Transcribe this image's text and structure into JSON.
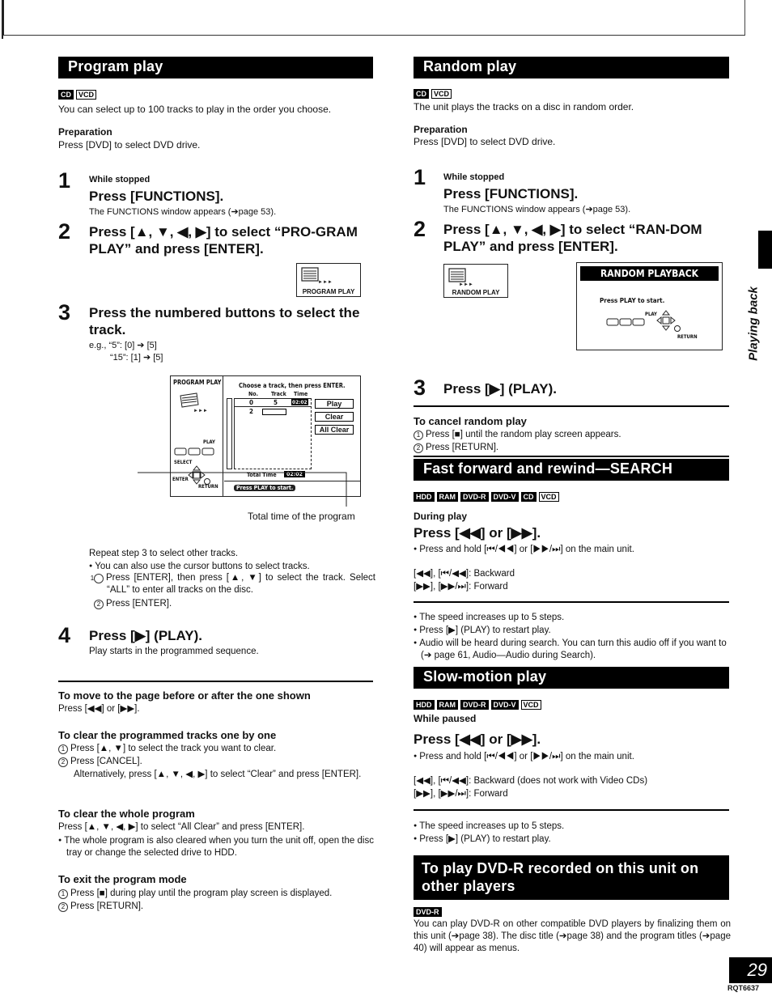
{
  "page": {
    "page_number": "29",
    "doc_id": "RQT6637",
    "side_tab_label": "Playing back"
  },
  "program_play": {
    "title": "Program play",
    "badges": [
      {
        "label": "CD",
        "style": "fill"
      },
      {
        "label": "VCD",
        "style": "outline"
      }
    ],
    "intro": "You can select up to 100 tracks to play in the order you choose.",
    "prep_label": "Preparation",
    "prep_text": "Press [DVD] to select DVD drive.",
    "steps": [
      {
        "num": "1",
        "pre": "While stopped",
        "title": "Press [FUNCTIONS].",
        "note": "The FUNCTIONS window appears (➔page 53)."
      },
      {
        "num": "2",
        "title": "Press [▲, ▼, ◀, ▶] to select “PRO-GRAM PLAY” and press [ENTER].",
        "icon_label": "PROGRAM PLAY"
      },
      {
        "num": "3",
        "title": "Press the numbered buttons to select the track.",
        "eg1": "e.g., “5”:   [0] ➔ [5]",
        "eg2": "“15”: [1] ➔ [5]"
      },
      {
        "num": "4",
        "title": "Press [▶] (PLAY).",
        "note": "Play starts in the programmed sequence."
      }
    ],
    "osd": {
      "side_title": "PROGRAM PLAY",
      "instruction": "Choose a track, then press ENTER.",
      "col_no": "No.",
      "col_track": "Track",
      "col_time": "Time",
      "rows": [
        {
          "no": "0",
          "track": "5",
          "time": "02:02"
        },
        {
          "no": "2",
          "track": "",
          "time": ""
        }
      ],
      "buttons": [
        "Play",
        "Clear",
        "All Clear"
      ],
      "total_label": "Total Time",
      "total_value": "02:02",
      "footer": "Press PLAY to start.",
      "play_label": "PLAY",
      "select_label": "SELECT",
      "enter_label": "ENTER",
      "return_label": "RETURN"
    },
    "callout": "Total time of the program",
    "repeat": "Repeat step 3 to select other tracks.",
    "cursor_bullet": "You can also use the cursor buttons to select tracks.",
    "cursor_sub1": "Press [ENTER], then press [▲, ▼] to select the track. Select “ALL” to enter all tracks on the disc.",
    "cursor_sub2": "Press [ENTER].",
    "move_head": "To move to the page before or after the one shown",
    "move_text": "Press [◀◀] or [▶▶].",
    "clear_one_head": "To clear the programmed tracks one by one",
    "clear_one_1": "Press [▲, ▼] to select the track you want to clear.",
    "clear_one_2": "Press [CANCEL].",
    "clear_one_alt": "Alternatively, press [▲, ▼, ◀, ▶] to select “Clear” and press [ENTER].",
    "clear_all_head": "To clear the whole program",
    "clear_all_text": "Press [▲, ▼, ◀, ▶] to select “All Clear” and press [ENTER].",
    "clear_all_bullet": "The whole program is also cleared when you turn the unit off, open the disc tray or change the selected drive to HDD.",
    "exit_head": "To exit the program mode",
    "exit_1": "Press [■] during play until the program play screen is displayed.",
    "exit_2": "Press [RETURN]."
  },
  "random_play": {
    "title": "Random play",
    "badges": [
      {
        "label": "CD",
        "style": "fill"
      },
      {
        "label": "VCD",
        "style": "outline"
      }
    ],
    "intro": "The unit plays the tracks on a disc in random order.",
    "prep_label": "Preparation",
    "prep_text": "Press [DVD] to select DVD drive.",
    "steps": [
      {
        "num": "1",
        "pre": "While stopped",
        "title": "Press [FUNCTIONS].",
        "note": "The FUNCTIONS window appears (➔page 53)."
      },
      {
        "num": "2",
        "title": "Press [▲, ▼, ◀, ▶] to select “RAN-DOM PLAY” and press [ENTER].",
        "icon_label": "RANDOM PLAY"
      },
      {
        "num": "3",
        "title": "Press [▶] (PLAY)."
      }
    ],
    "osd": {
      "title": "RANDOM PLAYBACK",
      "message": "Press PLAY to start.",
      "play_label": "PLAY",
      "return_label": "RETURN"
    },
    "cancel_head": "To cancel random play",
    "cancel_1": "Press [■] until the random play screen appears.",
    "cancel_2": "Press [RETURN]."
  },
  "search": {
    "title": "Fast forward and rewind—SEARCH",
    "badges": [
      {
        "label": "HDD",
        "style": "fill"
      },
      {
        "label": "RAM",
        "style": "fill"
      },
      {
        "label": "DVD-R",
        "style": "fill"
      },
      {
        "label": "DVD-V",
        "style": "fill"
      },
      {
        "label": "CD",
        "style": "fill"
      },
      {
        "label": "VCD",
        "style": "outline"
      }
    ],
    "condition": "During play",
    "title2": "Press [◀◀] or [▶▶].",
    "hold": "Press and hold [⏮/◀◀] or [▶▶/⏭] on the main unit.",
    "backward": "[◀◀], [⏮/◀◀]: Backward",
    "forward": "[▶▶], [▶▶/⏭]: Forward",
    "notes": [
      "The speed increases up to 5 steps.",
      "Press [▶] (PLAY) to restart play.",
      "Audio will be heard during search. You can turn this audio off if you want to (➔ page 61, Audio—Audio during Search)."
    ]
  },
  "slow": {
    "title": "Slow-motion play",
    "badges": [
      {
        "label": "HDD",
        "style": "fill"
      },
      {
        "label": "RAM",
        "style": "fill"
      },
      {
        "label": "DVD-R",
        "style": "fill"
      },
      {
        "label": "DVD-V",
        "style": "fill"
      },
      {
        "label": "VCD",
        "style": "outline"
      }
    ],
    "condition": "While paused",
    "title2": "Press [◀◀] or [▶▶].",
    "hold": "Press and hold [⏮/◀◀] or [▶▶/⏭] on the main unit.",
    "backward": "[◀◀], [⏮/◀◀]: Backward (does not work with Video CDs)",
    "forward": "[▶▶], [▶▶/⏭]: Forward",
    "notes": [
      "The speed increases up to 5 steps.",
      "Press [▶] (PLAY) to restart play."
    ]
  },
  "dvdr": {
    "title": "To play DVD-R recorded on this unit on other players",
    "badges": [
      {
        "label": "DVD-R",
        "style": "fill"
      }
    ],
    "text": "You can play DVD-R on other compatible DVD players by finalizing them on this unit (➔page 38). The disc title (➔page 38) and the program titles (➔page 40) will appear as menus."
  }
}
